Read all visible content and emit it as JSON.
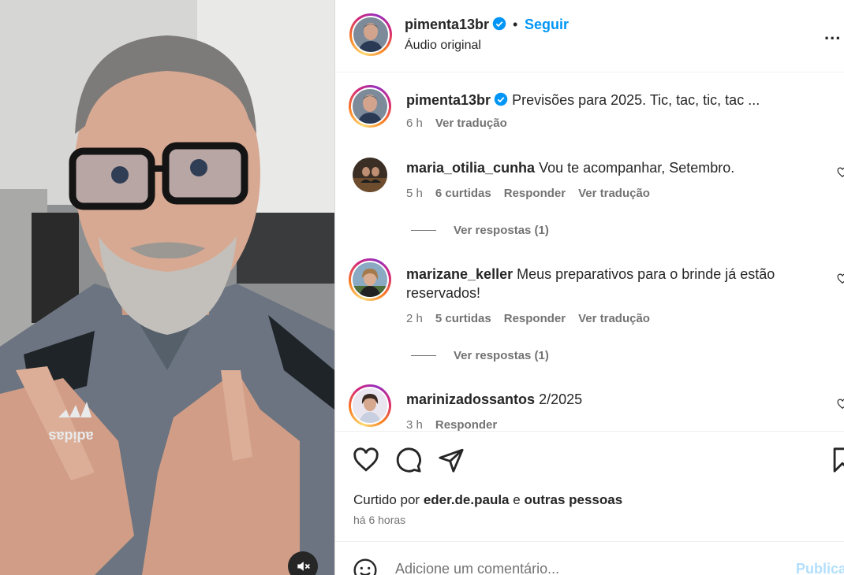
{
  "post": {
    "username": "pimenta13br",
    "separator": "•",
    "follow_label": "Seguir",
    "audio": "Áudio original",
    "more_label": "...",
    "caption": "Previsões para 2025. Tic, tac, tic, tac ...",
    "caption_time": "6 h",
    "caption_translate": "Ver tradução",
    "brand_print": "adidas"
  },
  "comments": [
    {
      "username": "maria_otilia_cunha",
      "text": "Vou te acompanhar, Setembro.",
      "time": "5 h",
      "likes": "6 curtidas",
      "reply": "Responder",
      "translate": "Ver tradução",
      "replies": "Ver respostas (1)"
    },
    {
      "username": "marizane_keller",
      "text": "Meus preparativos para o brinde já estão reservados!",
      "time": "2 h",
      "likes": "5 curtidas",
      "reply": "Responder",
      "translate": "Ver tradução",
      "replies": "Ver respostas (1)"
    },
    {
      "username": "marinizadossantos",
      "text": "2/2025",
      "time": "3 h",
      "reply": "Responder"
    }
  ],
  "actions": {
    "liked_by_prefix": "Curtido por",
    "liked_by_user": "eder.de.paula",
    "liked_by_and": "e",
    "liked_by_others": "outras pessoas",
    "time_ago": "há 6 horas"
  },
  "composer": {
    "placeholder": "Adicione um comentário...",
    "publish_label": "Publicar"
  },
  "colors": {
    "link_blue": "#0095f6",
    "verified_blue": "#0095f6",
    "muted_text": "#737373",
    "publish_disabled": "#b2dffc"
  }
}
